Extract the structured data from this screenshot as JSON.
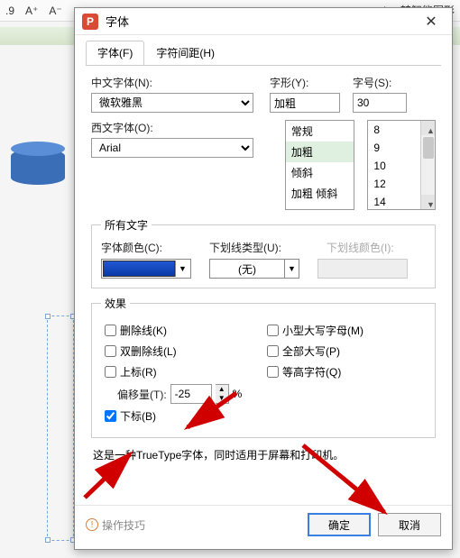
{
  "bg_toolbar": {
    "t1": ".9",
    "t2": "A⁺",
    "t3": "A⁻",
    "t4": "ab",
    "t5": "转智能图形"
  },
  "dialog": {
    "app_letter": "P",
    "title": "字体",
    "tabs": {
      "font": "字体(F)",
      "spacing": "字符间距(H)"
    },
    "labels": {
      "cn_font": "中文字体(N):",
      "style": "字形(Y):",
      "size": "字号(S):",
      "west_font": "西文字体(O):"
    },
    "cn_font_value": "微软雅黑",
    "west_font_value": "Arial",
    "style_value": "加粗",
    "size_value": "30",
    "style_options": [
      "常规",
      "加粗",
      "倾斜",
      "加粗 倾斜"
    ],
    "size_options": [
      "8",
      "9",
      "10",
      "12",
      "14"
    ],
    "all_text": {
      "legend": "所有文字",
      "font_color": "字体颜色(C):",
      "underline_type": "下划线类型(U):",
      "underline_color": "下划线颜色(I):",
      "underline_value": "(无)"
    },
    "effects": {
      "legend": "效果",
      "strikethrough": "删除线(K)",
      "dbl_strikethrough": "双删除线(L)",
      "superscript": "上标(R)",
      "offset_label": "偏移量(T):",
      "offset_value": "-25",
      "offset_unit": "%",
      "subscript": "下标(B)",
      "subscript_checked": true,
      "smallcaps": "小型大写字母(M)",
      "allcaps": "全部大写(P)",
      "equalheight": "等高字符(Q)"
    },
    "info_text": "这是一种TrueType字体，同时适用于屏幕和打印机。",
    "footer": {
      "tips": "操作技巧",
      "ok": "确定",
      "cancel": "取消"
    }
  }
}
